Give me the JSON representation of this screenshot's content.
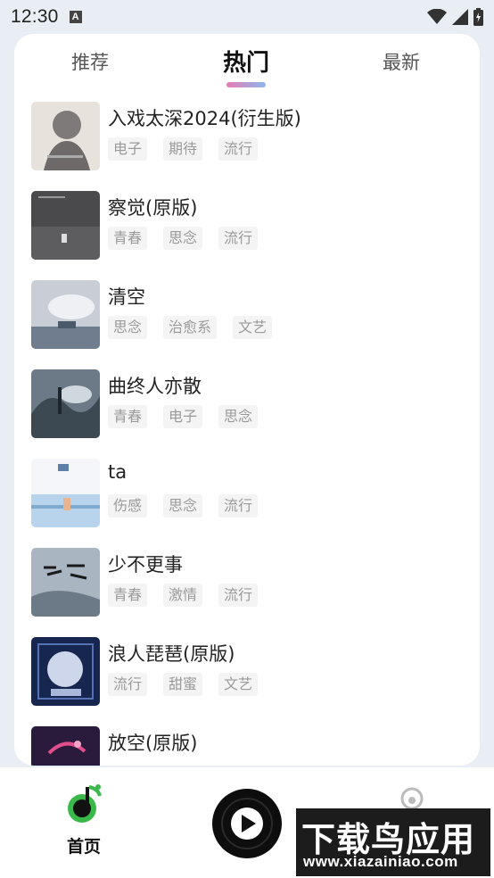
{
  "status_bar": {
    "time": "12:30",
    "notification_icon": "A"
  },
  "tabs": [
    {
      "label": "推荐",
      "active": false
    },
    {
      "label": "热门",
      "active": true
    },
    {
      "label": "最新",
      "active": false
    }
  ],
  "songs": [
    {
      "title": "入戏太深2024(衍生版)",
      "tags": [
        "电子",
        "期待",
        "流行"
      ]
    },
    {
      "title": "察觉(原版)",
      "tags": [
        "青春",
        "思念",
        "流行"
      ]
    },
    {
      "title": "清空",
      "tags": [
        "思念",
        "治愈系",
        "文艺"
      ]
    },
    {
      "title": "曲终人亦散",
      "tags": [
        "青春",
        "电子",
        "思念"
      ]
    },
    {
      "title": "ta",
      "tags": [
        "伤感",
        "思念",
        "流行"
      ]
    },
    {
      "title": "少不更事",
      "tags": [
        "青春",
        "激情",
        "流行"
      ]
    },
    {
      "title": "浪人琵琶(原版)",
      "tags": [
        "流行",
        "甜蜜",
        "文艺"
      ]
    },
    {
      "title": "放空(原版)",
      "tags": []
    }
  ],
  "bottom_nav": {
    "home_label": "首页"
  },
  "watermark": {
    "main": "下载鸟应用",
    "url": "www.xiazainiao.com"
  },
  "colors": {
    "accent_green": "#3bb84a",
    "tab_indicator_start": "#e77db0",
    "tab_indicator_end": "#8bb7ee"
  }
}
